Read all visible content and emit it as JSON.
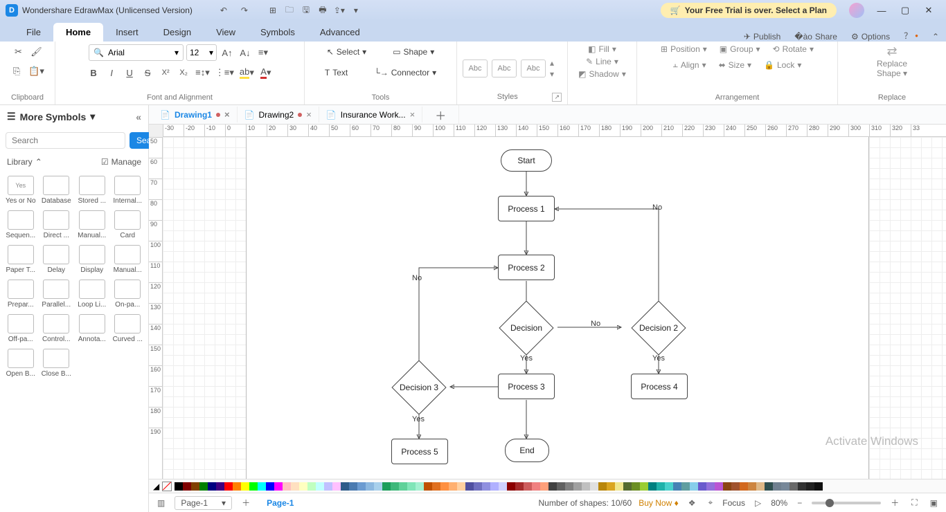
{
  "app": {
    "title": "Wondershare EdrawMax (Unlicensed Version)"
  },
  "trial": {
    "text": "Your Free Trial is over. Select a Plan"
  },
  "menu": {
    "tabs": [
      "File",
      "Home",
      "Insert",
      "Design",
      "View",
      "Symbols",
      "Advanced"
    ],
    "active": "Home",
    "right": {
      "publish": "Publish",
      "share": "Share",
      "options": "Options"
    }
  },
  "ribbon": {
    "clipboard": {
      "label": "Clipboard"
    },
    "font": {
      "name": "Arial",
      "size": "12",
      "label": "Font and Alignment"
    },
    "tools": {
      "select": "Select",
      "shape": "Shape",
      "text": "Text",
      "connector": "Connector",
      "label": "Tools"
    },
    "styles": {
      "abc": "Abc",
      "label": "Styles"
    },
    "styleopts": {
      "fill": "Fill",
      "line": "Line",
      "shadow": "Shadow"
    },
    "arrange": {
      "position": "Position",
      "group": "Group",
      "rotate": "Rotate",
      "align": "Align",
      "size": "Size",
      "lock": "Lock",
      "label": "Arrangement"
    },
    "replace": {
      "top": "Replace",
      "bottom": "Shape",
      "label": "Replace"
    }
  },
  "sidebar": {
    "title": "More Symbols",
    "search_placeholder": "Search",
    "search_btn": "Search",
    "library": "Library",
    "manage": "Manage",
    "shapes": [
      {
        "lbl": "Yes or No",
        "glyph": "Yes"
      },
      {
        "lbl": "Database",
        "glyph": ""
      },
      {
        "lbl": "Stored ...",
        "glyph": ""
      },
      {
        "lbl": "Internal...",
        "glyph": ""
      },
      {
        "lbl": "Sequen...",
        "glyph": ""
      },
      {
        "lbl": "Direct ...",
        "glyph": ""
      },
      {
        "lbl": "Manual...",
        "glyph": ""
      },
      {
        "lbl": "Card",
        "glyph": ""
      },
      {
        "lbl": "Paper T...",
        "glyph": ""
      },
      {
        "lbl": "Delay",
        "glyph": ""
      },
      {
        "lbl": "Display",
        "glyph": ""
      },
      {
        "lbl": "Manual...",
        "glyph": ""
      },
      {
        "lbl": "Prepar...",
        "glyph": ""
      },
      {
        "lbl": "Parallel...",
        "glyph": ""
      },
      {
        "lbl": "Loop Li...",
        "glyph": ""
      },
      {
        "lbl": "On-pa...",
        "glyph": ""
      },
      {
        "lbl": "Off-pa...",
        "glyph": ""
      },
      {
        "lbl": "Control...",
        "glyph": ""
      },
      {
        "lbl": "Annota...",
        "glyph": ""
      },
      {
        "lbl": "Curved ...",
        "glyph": ""
      },
      {
        "lbl": "Open B...",
        "glyph": ""
      },
      {
        "lbl": "Close B...",
        "glyph": ""
      }
    ]
  },
  "doc_tabs": [
    {
      "name": "Drawing1",
      "active": true,
      "dirty": true
    },
    {
      "name": "Drawing2",
      "active": false,
      "dirty": true
    },
    {
      "name": "Insurance Work...",
      "active": false,
      "dirty": false
    }
  ],
  "hruler": [
    "-30",
    "-20",
    "-10",
    "0",
    "10",
    "20",
    "30",
    "40",
    "50",
    "60",
    "70",
    "80",
    "90",
    "100",
    "110",
    "120",
    "130",
    "140",
    "150",
    "160",
    "170",
    "180",
    "190",
    "200",
    "210",
    "220",
    "230",
    "240",
    "250",
    "260",
    "270",
    "280",
    "290",
    "300",
    "310",
    "320",
    "33"
  ],
  "vruler": [
    "50",
    "60",
    "70",
    "80",
    "90",
    "100",
    "110",
    "120",
    "130",
    "140",
    "150",
    "160",
    "170",
    "180",
    "190"
  ],
  "flow": {
    "start": "Start",
    "p1": "Process 1",
    "p2": "Process 2",
    "d1": "Decision",
    "d2": "Decision 2",
    "d3": "Decision 3",
    "p3": "Process 3",
    "p4": "Process 4",
    "p5": "Process 5",
    "end": "End",
    "yes": "Yes",
    "no": "No"
  },
  "colorbar": [
    "#000000",
    "#7f0000",
    "#804000",
    "#008000",
    "#000080",
    "#400080",
    "#ff0000",
    "#ff8000",
    "#ffff00",
    "#00ff00",
    "#00ffff",
    "#0000ff",
    "#ff00ff",
    "#ffc0c0",
    "#ffe0c0",
    "#ffffc0",
    "#c0ffc0",
    "#c0ffff",
    "#c0c0ff",
    "#ffc0ff",
    "#2e5c8a",
    "#4a7ab0",
    "#6b9bd1",
    "#8cb8e0",
    "#a8d0ec",
    "#1b9e5b",
    "#3db87a",
    "#5fd199",
    "#81e5b8",
    "#a3f0d0",
    "#c05000",
    "#e07020",
    "#ff9040",
    "#ffb070",
    "#ffd0a0",
    "#5050a0",
    "#7070c0",
    "#9090e0",
    "#b0b0ff",
    "#d0d0ff",
    "#8b0000",
    "#a52a2a",
    "#cd5c5c",
    "#f08080",
    "#ffa07a",
    "#404040",
    "#606060",
    "#808080",
    "#a0a0a0",
    "#c0c0c0",
    "#e0e0e0",
    "#b8860b",
    "#daa520",
    "#f0e68c",
    "#556b2f",
    "#6b8e23",
    "#9acd32",
    "#008080",
    "#20b2aa",
    "#48d1cc",
    "#4682b4",
    "#5f9ea0",
    "#87ceeb",
    "#6a5acd",
    "#9370db",
    "#ba55d3",
    "#8b4513",
    "#a0522d",
    "#d2691e",
    "#cd853f",
    "#deb887",
    "#2f4f4f",
    "#708090",
    "#778899",
    "#696969",
    "#333333",
    "#222222",
    "#111111"
  ],
  "status": {
    "page_sel": "Page-1",
    "page_tab": "Page-1",
    "shapes": "Number of shapes: 10/60",
    "buynow": "Buy Now",
    "focus": "Focus",
    "zoom": "80%"
  },
  "watermark": "Activate Windows"
}
